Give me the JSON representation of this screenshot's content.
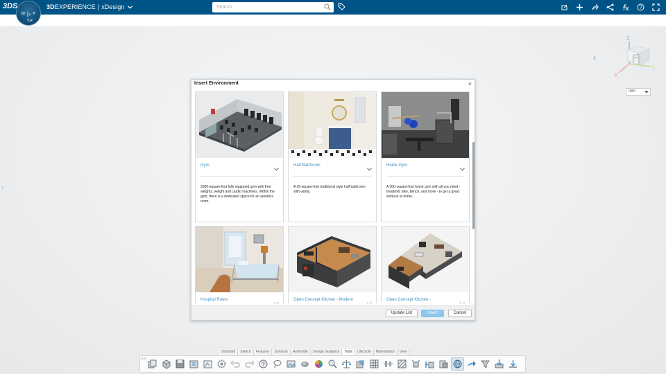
{
  "app": {
    "brand_bold": "3D",
    "brand_rest": "EXPERIENCE",
    "separator": "|",
    "app_name": "xDesign",
    "logo_text": "3DS",
    "compass": {
      "top": "",
      "left": "3D",
      "center": "▷",
      "right": "P",
      "bottom": "V,R"
    }
  },
  "search": {
    "placeholder": "Search"
  },
  "top_icons": [
    "share-icon",
    "plus-icon",
    "share-arrow-icon",
    "network-icon",
    "fx-icon",
    "help-icon",
    "expand-icon"
  ],
  "viewcube": {
    "axis_z": "Z",
    "axis_x": "X",
    "axis_y": "Y"
  },
  "unit": {
    "value": "mm"
  },
  "dialog": {
    "title": "Insert Environment",
    "close": "×",
    "cards": [
      {
        "name": "Gym",
        "description": "2000-square-foot fully equipped gym with free weights, weight and cardio machines. Within the gym, there is a dedicated space for an aerobics room."
      },
      {
        "name": "Half-Bathroom",
        "description": "A 25-square-foot traditional style half bathroom with vanity."
      },
      {
        "name": "Home Gym",
        "description": "A 300-square-foot home gym with all you need - treadmill, bike, bench, and more - to get a great workout at home."
      },
      {
        "name": "Hospital Room",
        "description": ""
      },
      {
        "name": "Open Concept Kitchen - Modern",
        "description": ""
      },
      {
        "name": "Open Concept Kitchen -",
        "description": ""
      }
    ],
    "buttons": {
      "update": "Update List",
      "insert": "Insert",
      "cancel": "Cancel"
    }
  },
  "action_bar": {
    "tabs": [
      "Standard",
      "Sketch",
      "Features",
      "Surfaces",
      "Assemble",
      "Design Guidance",
      "Tools",
      "Lifecycle",
      "Marketplace",
      "View"
    ],
    "active_tab": "Tools",
    "toggle": "<>"
  },
  "colors": {
    "topbar": "#005386",
    "link": "#3c8ec1",
    "insert_button": "#8fc6ea"
  }
}
